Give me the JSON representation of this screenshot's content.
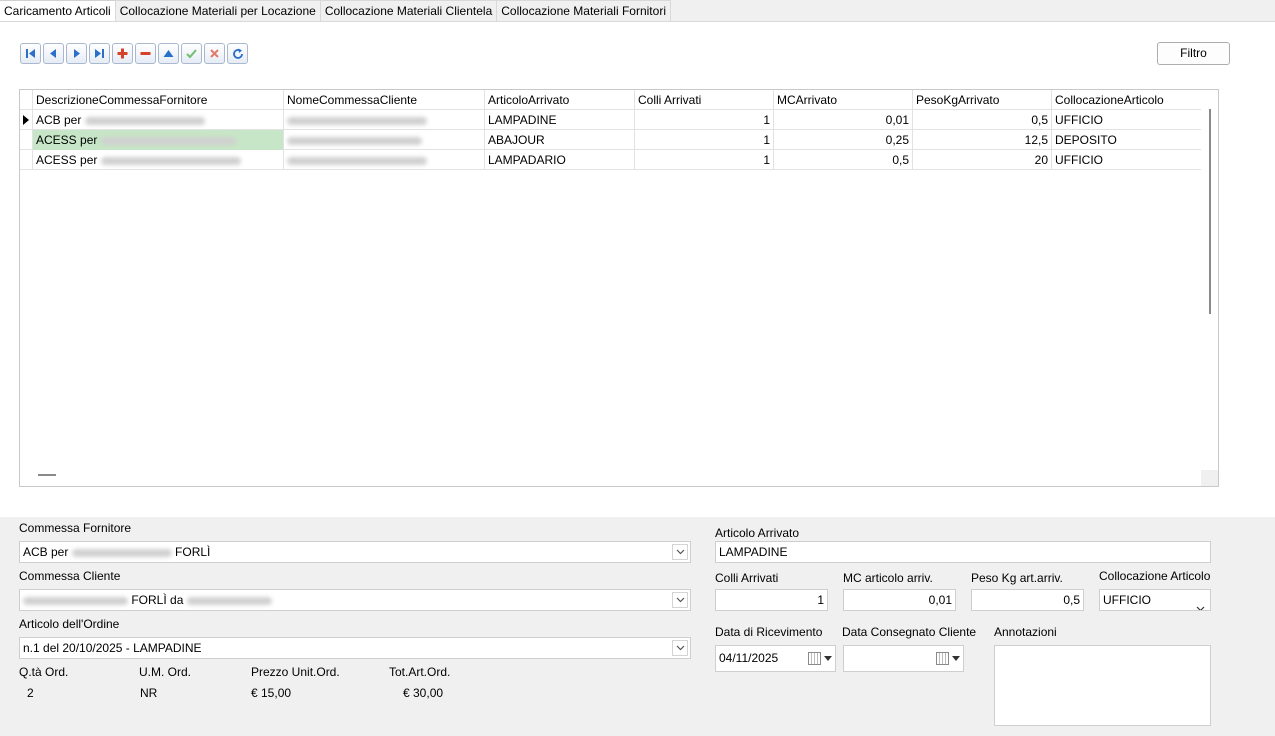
{
  "tabs": [
    {
      "label": "Caricamento Articoli",
      "active": true
    },
    {
      "label": "Collocazione Materiali per Locazione",
      "active": false
    },
    {
      "label": "Collocazione Materiali Clientela",
      "active": false
    },
    {
      "label": "Collocazione Materiali Fornitori",
      "active": false
    }
  ],
  "toolbar": {
    "buttons": [
      "first-record-icon",
      "prior-record-icon",
      "next-record-icon",
      "last-record-icon",
      "insert-icon",
      "delete-icon",
      "edit-icon",
      "post-icon",
      "cancel-icon",
      "refresh-icon"
    ],
    "filtro_label": "Filtro"
  },
  "grid": {
    "columns": [
      "DescrizioneCommessaFornitore",
      "NomeCommessaCliente",
      "ArticoloArrivato",
      "Colli Arrivati",
      "MCArrivato",
      "PesoKgArrivato",
      "CollocazioneArticolo"
    ],
    "rows": [
      {
        "descr": "ACB per",
        "articolo": "LAMPADINE",
        "colli": "1",
        "mc": "0,01",
        "peso": "0,5",
        "collocazione": "UFFICIO",
        "current": true
      },
      {
        "descr": "ACESS per",
        "articolo": "ABAJOUR",
        "colli": "1",
        "mc": "0,25",
        "peso": "12,5",
        "collocazione": "DEPOSITO",
        "current": false
      },
      {
        "descr": "ACESS per",
        "articolo": "LAMPADARIO",
        "colli": "1",
        "mc": "0,5",
        "peso": "20",
        "collocazione": "UFFICIO",
        "current": false
      }
    ]
  },
  "form": {
    "commessa_fornitore_label": "Commessa Fornitore",
    "commessa_fornitore_prefix": "ACB per",
    "commessa_fornitore_suffix": "FORLÌ",
    "commessa_cliente_label": "Commessa Cliente",
    "commessa_cliente_mid": "FORLÌ da",
    "articolo_ordine_label": "Articolo dell'Ordine",
    "articolo_ordine_value": "n.1 del 20/10/2025 - LAMPADINE",
    "qta_label": "Q.tà Ord.",
    "qta_value": "2",
    "um_label": "U.M. Ord.",
    "um_value": "NR",
    "prezzo_label": "Prezzo Unit.Ord.",
    "prezzo_value": "€ 15,00",
    "tot_label": "Tot.Art.Ord.",
    "tot_value": "€ 30,00",
    "articolo_arrivato_label": "Articolo Arrivato",
    "articolo_arrivato_value": "LAMPADINE",
    "colli_label": "Colli Arrivati",
    "colli_value": "1",
    "mc_label": "MC articolo arriv.",
    "mc_value": "0,01",
    "peso_label": "Peso Kg art.arriv.",
    "peso_value": "0,5",
    "collocazione_label": "Collocazione Articolo",
    "collocazione_value": "UFFICIO",
    "data_ricevimento_label": "Data di Ricevimento",
    "data_ricevimento_value": "04/11/2025",
    "data_consegnato_label": "Data Consegnato Cliente",
    "data_consegnato_value": "",
    "annotazioni_label": "Annotazioni"
  },
  "colors": {
    "selected_cell": "#c7e6c7",
    "nav_blue": "#2a6fc9",
    "insert_red": "#d64228",
    "post_green": "#6fbf73",
    "cancel_red": "#e07a6a"
  }
}
